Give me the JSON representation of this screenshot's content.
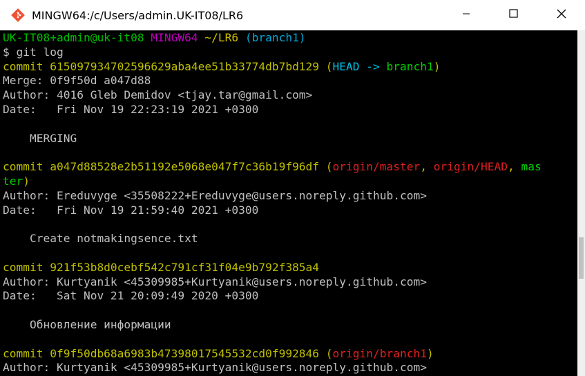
{
  "window": {
    "title": "MINGW64:/c/Users/admin.UK-IT08/LR6",
    "icon": "git-bash-icon",
    "controls": [
      "minimize-icon",
      "maximize-icon",
      "close-icon"
    ]
  },
  "colors": {
    "default": "#c0c0c0",
    "prompt_user": "#00c000",
    "prompt_shell": "#c000c0",
    "prompt_path": "#d0c000",
    "prompt_branch": "#00a8d8",
    "commit": "#c0c000",
    "head": "#00c0e0",
    "local_branch": "#00d000",
    "remote_branch": "#e02020",
    "punct": "#c0c000"
  },
  "terminal": {
    "lines": [
      [
        {
          "t": "UK-IT08+admin@uk-it08 ",
          "c": "prompt_user"
        },
        {
          "t": "MINGW64 ",
          "c": "prompt_shell"
        },
        {
          "t": "~/LR6",
          "c": "prompt_path"
        },
        {
          "t": " (branch1)",
          "c": "prompt_branch"
        }
      ],
      [
        {
          "t": "$ git log",
          "c": "default"
        }
      ],
      [
        {
          "t": "commit 615097934702596629aba4ee51b33774db7bd129 (",
          "c": "commit"
        },
        {
          "t": "HEAD -> ",
          "c": "head"
        },
        {
          "t": "branch1",
          "c": "local_branch"
        },
        {
          "t": ")",
          "c": "punct"
        }
      ],
      [
        {
          "t": "Merge: 0f9f50d a047d88",
          "c": "default"
        }
      ],
      [
        {
          "t": "Author: 4016 Gleb Demidov <tjay.tar@gmail.com>",
          "c": "default"
        }
      ],
      [
        {
          "t": "Date:   Fri Nov 19 22:23:19 2021 +0300",
          "c": "default"
        }
      ],
      [
        {
          "t": "",
          "c": "default"
        }
      ],
      [
        {
          "t": "    MERGING",
          "c": "default"
        }
      ],
      [
        {
          "t": "",
          "c": "default"
        }
      ],
      [
        {
          "t": "commit a047d88528e2b51192e5068e047f7c36b19f96df (",
          "c": "commit"
        },
        {
          "t": "origin/master",
          "c": "remote_branch"
        },
        {
          "t": ", ",
          "c": "punct"
        },
        {
          "t": "origin/HEAD",
          "c": "remote_branch"
        },
        {
          "t": ", ",
          "c": "punct"
        },
        {
          "t": "mas",
          "c": "local_branch"
        }
      ],
      [
        {
          "t": "ter",
          "c": "local_branch"
        },
        {
          "t": ")",
          "c": "punct"
        }
      ],
      [
        {
          "t": "Author: Ereduvyge <35508222+Ereduvyge@users.noreply.github.com>",
          "c": "default"
        }
      ],
      [
        {
          "t": "Date:   Fri Nov 19 21:59:40 2021 +0300",
          "c": "default"
        }
      ],
      [
        {
          "t": "",
          "c": "default"
        }
      ],
      [
        {
          "t": "    Create notmakingsence.txt",
          "c": "default"
        }
      ],
      [
        {
          "t": "",
          "c": "default"
        }
      ],
      [
        {
          "t": "commit 921f53b8d0cebf542c791cf31f04e9b792f385a4",
          "c": "commit"
        }
      ],
      [
        {
          "t": "Author: Kurtyanik <45309985+Kurtyanik@users.noreply.github.com>",
          "c": "default"
        }
      ],
      [
        {
          "t": "Date:   Sat Nov 21 20:09:49 2020 +0300",
          "c": "default"
        }
      ],
      [
        {
          "t": "",
          "c": "default"
        }
      ],
      [
        {
          "t": "    Обновление информации",
          "c": "default"
        }
      ],
      [
        {
          "t": "",
          "c": "default"
        }
      ],
      [
        {
          "t": "commit 0f9f50db68a6983b47398017545532cd0f992846 (",
          "c": "commit"
        },
        {
          "t": "origin/branch1",
          "c": "remote_branch"
        },
        {
          "t": ")",
          "c": "punct"
        }
      ],
      [
        {
          "t": "Author: Kurtyanik <45309985+Kurtyanik@users.noreply.github.com>",
          "c": "default"
        }
      ]
    ]
  }
}
